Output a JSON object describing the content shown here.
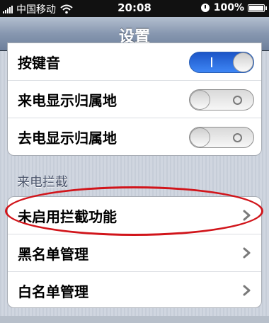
{
  "status_bar": {
    "carrier": "中国移动",
    "time": "20:08",
    "battery": "100%"
  },
  "nav": {
    "title": "设置"
  },
  "group1": {
    "rows": [
      {
        "label": "按键音",
        "toggle": "on"
      },
      {
        "label": "来电显示归属地",
        "toggle": "off"
      },
      {
        "label": "去电显示归属地",
        "toggle": "off"
      }
    ]
  },
  "section": {
    "header": "来电拦截"
  },
  "group2": {
    "rows": [
      {
        "label": "未启用拦截功能"
      },
      {
        "label": "黑名单管理"
      },
      {
        "label": "白名单管理"
      }
    ]
  },
  "colors": {
    "toggle_on": "#2f6fe4",
    "annotation": "#d1151b"
  },
  "icons": [
    "signal-icon",
    "wifi-icon",
    "lock-rotation-icon",
    "battery-icon",
    "chevron-right-icon"
  ]
}
